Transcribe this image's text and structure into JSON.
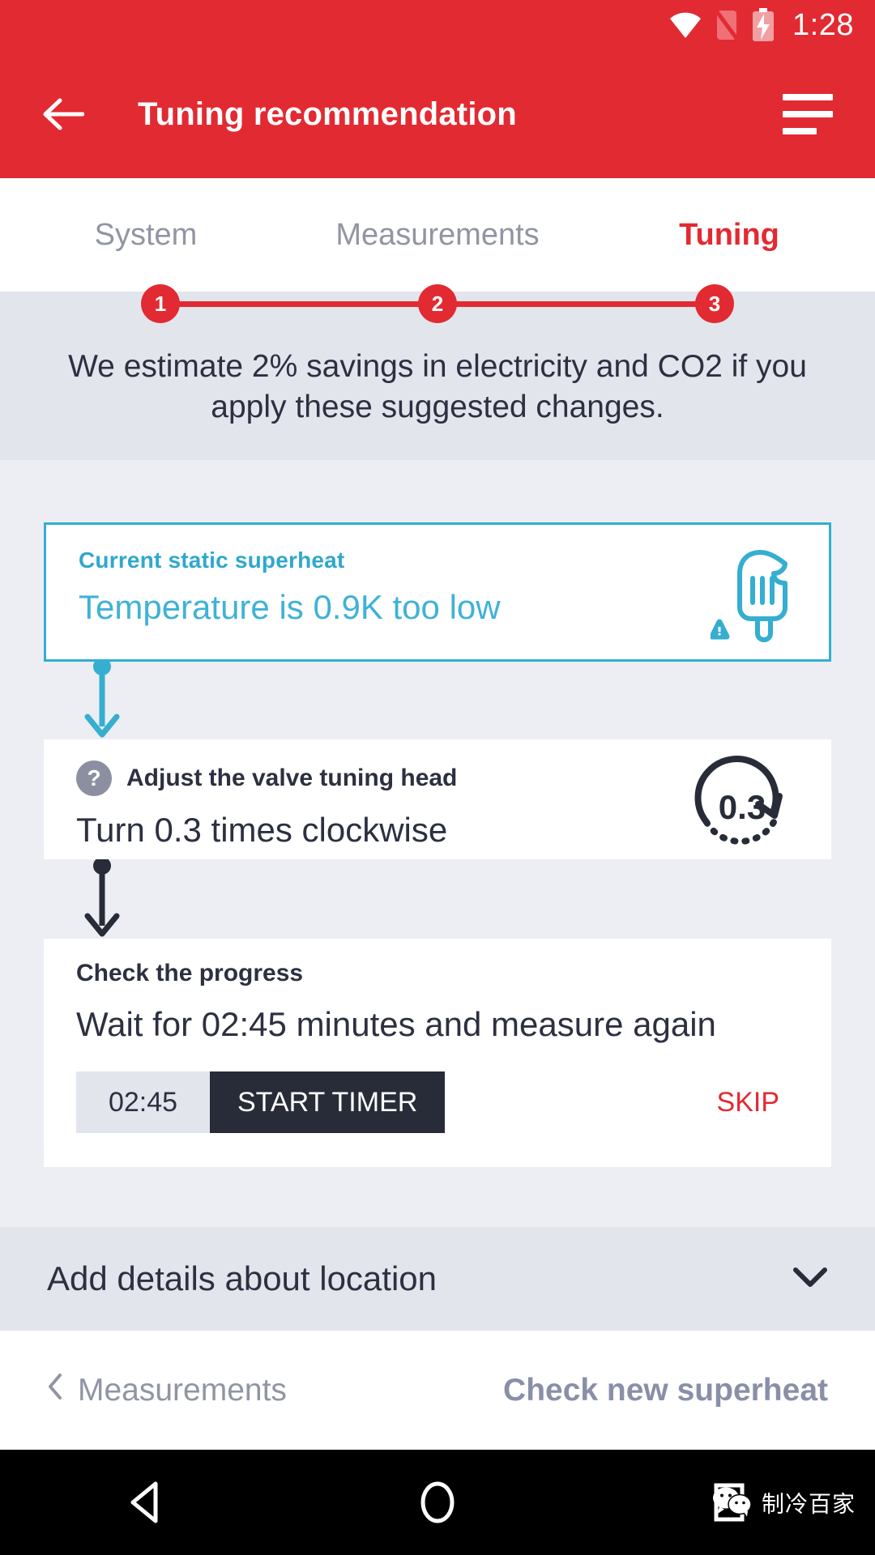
{
  "statusbar": {
    "clock": "1:28",
    "icons": [
      "wifi-icon",
      "sim-off-icon",
      "battery-charging-icon"
    ]
  },
  "header": {
    "title": "Tuning recommendation",
    "back_icon": "back-arrow-icon",
    "menu_icon": "hamburger-menu-icon"
  },
  "stepper": {
    "tabs": [
      {
        "label": "System",
        "step": "1",
        "active": false
      },
      {
        "label": "Measurements",
        "step": "2",
        "active": false
      },
      {
        "label": "Tuning",
        "step": "3",
        "active": true
      }
    ]
  },
  "savings": {
    "text": "We estimate 2% savings in electricity and CO2 if you apply these suggested changes."
  },
  "cards": {
    "superheat": {
      "label": "Current static superheat",
      "value": "Temperature is 0.9K too low",
      "icon": "popsicle-warning-icon"
    },
    "valve": {
      "title": "Adjust the valve tuning head",
      "instruction": "Turn 0.3 times clockwise",
      "help_icon": "question-mark-icon",
      "rotate_icon": "rotate-clockwise-icon",
      "rotate_value": "0.3"
    },
    "progress": {
      "title": "Check the progress",
      "text": "Wait for 02:45 minutes and measure again",
      "timer_value": "02:45",
      "start_label": "START TIMER",
      "skip_label": "SKIP"
    }
  },
  "location": {
    "label": "Add details about location",
    "chevron_icon": "chevron-down-icon"
  },
  "bottom_nav": {
    "prev_label": "Measurements",
    "prev_icon": "chevron-left-icon",
    "next_label": "Check new superheat"
  },
  "sysbar": {
    "back_icon": "android-back-icon",
    "home_icon": "android-home-icon",
    "recents_icon": "android-recents-icon",
    "watermark": "制冷百家"
  },
  "colors": {
    "brand_red": "#e22a32",
    "teal": "#35aed0",
    "dark": "#272c38",
    "banner_gray": "#e3e5ed"
  }
}
